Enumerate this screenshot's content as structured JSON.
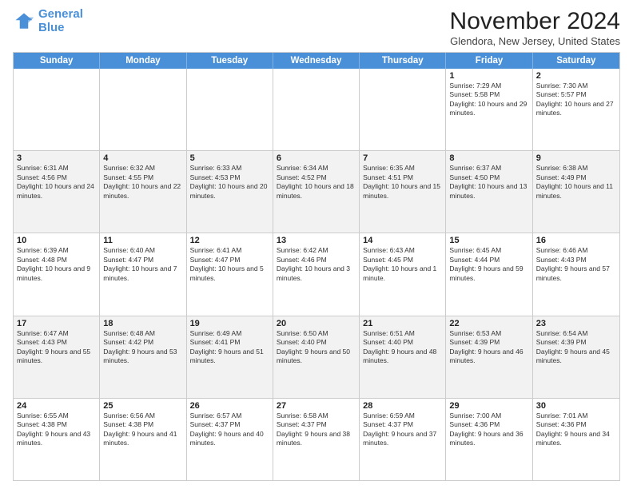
{
  "header": {
    "logo_line1": "General",
    "logo_line2": "Blue",
    "month": "November 2024",
    "location": "Glendora, New Jersey, United States"
  },
  "weekdays": [
    "Sunday",
    "Monday",
    "Tuesday",
    "Wednesday",
    "Thursday",
    "Friday",
    "Saturday"
  ],
  "rows": [
    {
      "alt": false,
      "cells": [
        {
          "day": "",
          "info": ""
        },
        {
          "day": "",
          "info": ""
        },
        {
          "day": "",
          "info": ""
        },
        {
          "day": "",
          "info": ""
        },
        {
          "day": "",
          "info": ""
        },
        {
          "day": "1",
          "info": "Sunrise: 7:29 AM\nSunset: 5:58 PM\nDaylight: 10 hours and 29 minutes."
        },
        {
          "day": "2",
          "info": "Sunrise: 7:30 AM\nSunset: 5:57 PM\nDaylight: 10 hours and 27 minutes."
        }
      ]
    },
    {
      "alt": true,
      "cells": [
        {
          "day": "3",
          "info": "Sunrise: 6:31 AM\nSunset: 4:56 PM\nDaylight: 10 hours and 24 minutes."
        },
        {
          "day": "4",
          "info": "Sunrise: 6:32 AM\nSunset: 4:55 PM\nDaylight: 10 hours and 22 minutes."
        },
        {
          "day": "5",
          "info": "Sunrise: 6:33 AM\nSunset: 4:53 PM\nDaylight: 10 hours and 20 minutes."
        },
        {
          "day": "6",
          "info": "Sunrise: 6:34 AM\nSunset: 4:52 PM\nDaylight: 10 hours and 18 minutes."
        },
        {
          "day": "7",
          "info": "Sunrise: 6:35 AM\nSunset: 4:51 PM\nDaylight: 10 hours and 15 minutes."
        },
        {
          "day": "8",
          "info": "Sunrise: 6:37 AM\nSunset: 4:50 PM\nDaylight: 10 hours and 13 minutes."
        },
        {
          "day": "9",
          "info": "Sunrise: 6:38 AM\nSunset: 4:49 PM\nDaylight: 10 hours and 11 minutes."
        }
      ]
    },
    {
      "alt": false,
      "cells": [
        {
          "day": "10",
          "info": "Sunrise: 6:39 AM\nSunset: 4:48 PM\nDaylight: 10 hours and 9 minutes."
        },
        {
          "day": "11",
          "info": "Sunrise: 6:40 AM\nSunset: 4:47 PM\nDaylight: 10 hours and 7 minutes."
        },
        {
          "day": "12",
          "info": "Sunrise: 6:41 AM\nSunset: 4:47 PM\nDaylight: 10 hours and 5 minutes."
        },
        {
          "day": "13",
          "info": "Sunrise: 6:42 AM\nSunset: 4:46 PM\nDaylight: 10 hours and 3 minutes."
        },
        {
          "day": "14",
          "info": "Sunrise: 6:43 AM\nSunset: 4:45 PM\nDaylight: 10 hours and 1 minute."
        },
        {
          "day": "15",
          "info": "Sunrise: 6:45 AM\nSunset: 4:44 PM\nDaylight: 9 hours and 59 minutes."
        },
        {
          "day": "16",
          "info": "Sunrise: 6:46 AM\nSunset: 4:43 PM\nDaylight: 9 hours and 57 minutes."
        }
      ]
    },
    {
      "alt": true,
      "cells": [
        {
          "day": "17",
          "info": "Sunrise: 6:47 AM\nSunset: 4:43 PM\nDaylight: 9 hours and 55 minutes."
        },
        {
          "day": "18",
          "info": "Sunrise: 6:48 AM\nSunset: 4:42 PM\nDaylight: 9 hours and 53 minutes."
        },
        {
          "day": "19",
          "info": "Sunrise: 6:49 AM\nSunset: 4:41 PM\nDaylight: 9 hours and 51 minutes."
        },
        {
          "day": "20",
          "info": "Sunrise: 6:50 AM\nSunset: 4:40 PM\nDaylight: 9 hours and 50 minutes."
        },
        {
          "day": "21",
          "info": "Sunrise: 6:51 AM\nSunset: 4:40 PM\nDaylight: 9 hours and 48 minutes."
        },
        {
          "day": "22",
          "info": "Sunrise: 6:53 AM\nSunset: 4:39 PM\nDaylight: 9 hours and 46 minutes."
        },
        {
          "day": "23",
          "info": "Sunrise: 6:54 AM\nSunset: 4:39 PM\nDaylight: 9 hours and 45 minutes."
        }
      ]
    },
    {
      "alt": false,
      "cells": [
        {
          "day": "24",
          "info": "Sunrise: 6:55 AM\nSunset: 4:38 PM\nDaylight: 9 hours and 43 minutes."
        },
        {
          "day": "25",
          "info": "Sunrise: 6:56 AM\nSunset: 4:38 PM\nDaylight: 9 hours and 41 minutes."
        },
        {
          "day": "26",
          "info": "Sunrise: 6:57 AM\nSunset: 4:37 PM\nDaylight: 9 hours and 40 minutes."
        },
        {
          "day": "27",
          "info": "Sunrise: 6:58 AM\nSunset: 4:37 PM\nDaylight: 9 hours and 38 minutes."
        },
        {
          "day": "28",
          "info": "Sunrise: 6:59 AM\nSunset: 4:37 PM\nDaylight: 9 hours and 37 minutes."
        },
        {
          "day": "29",
          "info": "Sunrise: 7:00 AM\nSunset: 4:36 PM\nDaylight: 9 hours and 36 minutes."
        },
        {
          "day": "30",
          "info": "Sunrise: 7:01 AM\nSunset: 4:36 PM\nDaylight: 9 hours and 34 minutes."
        }
      ]
    }
  ]
}
